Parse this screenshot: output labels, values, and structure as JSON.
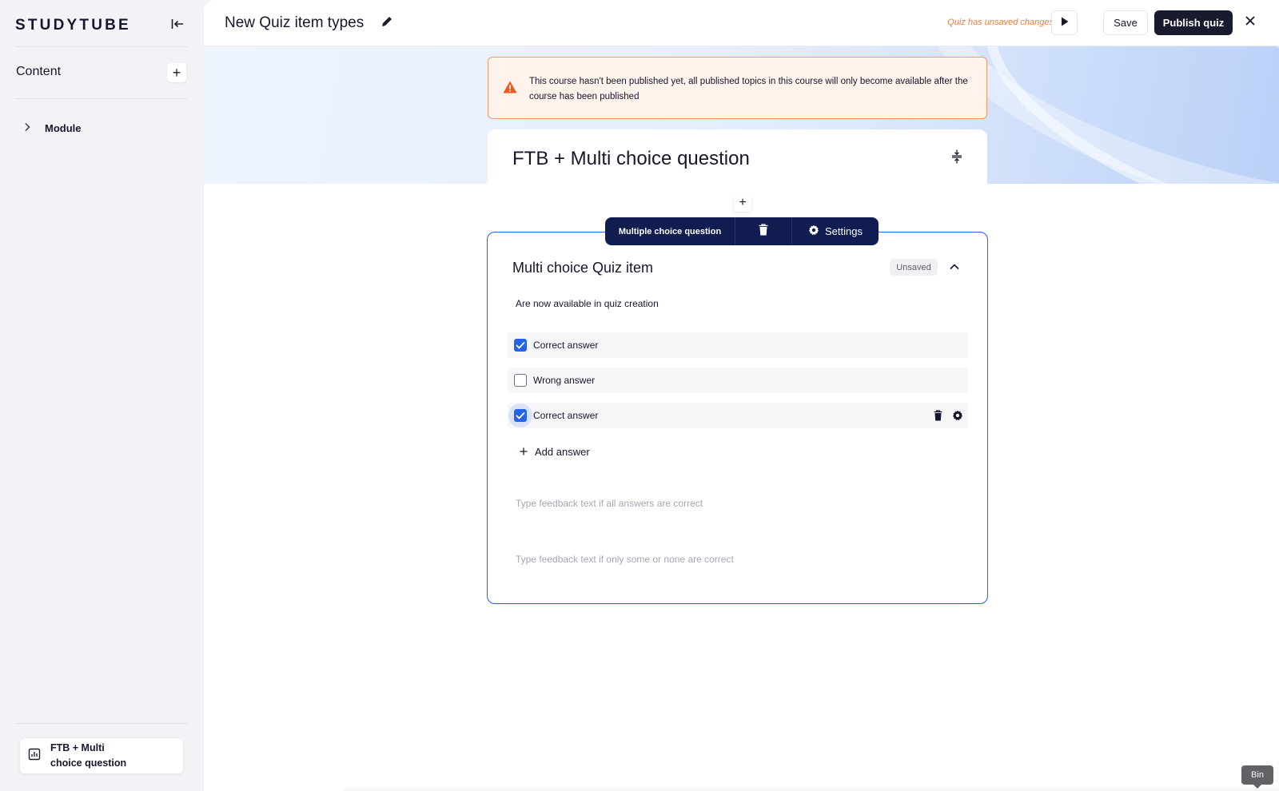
{
  "sidebar": {
    "logo": "STUDYTUBE",
    "content_label": "Content",
    "add_label": "+",
    "module_label": "Module",
    "bottom_item_label": "FTB + Multi choice question"
  },
  "topbar": {
    "title": "New Quiz item types",
    "unsaved_note": "Quiz has unsaved changes",
    "save_label": "Save",
    "publish_label": "Publish quiz"
  },
  "notice": {
    "text": "This course hasn't been published yet, all published topics in this course will only become available after the course has been published"
  },
  "topic": {
    "title": "FTB + Multi choice question"
  },
  "add_block_label": "+",
  "toolbar": {
    "type_label": "Multiple choice question",
    "settings_label": "Settings"
  },
  "quiz_item": {
    "title": "Multi choice Quiz item",
    "status_badge": "Unsaved",
    "question": "Are now available in quiz creation",
    "answers": [
      {
        "label": "Correct answer",
        "checked": true
      },
      {
        "label": "Wrong answer",
        "checked": false
      },
      {
        "label": "Correct answer",
        "checked": true
      }
    ],
    "add_answer_label": "Add answer",
    "feedback_correct_placeholder": "Type feedback text if all answers are correct",
    "feedback_incorrect_placeholder": "Type feedback text if only some or none are correct"
  },
  "tooltip": {
    "bin_label": "Bin"
  },
  "colors": {
    "accent": "#2563eb",
    "toolbar_bg": "#111c50",
    "publish_bg": "#181a2e",
    "warning": "#ef5a1f",
    "unsaved_text": "#ef7b3c"
  },
  "icons": [
    "collapse-sidebar-icon",
    "chevron-right-icon",
    "chart-icon",
    "pencil-icon",
    "play-icon",
    "close-icon",
    "warning-icon",
    "collapse-all-icon",
    "trash-icon",
    "gear-icon",
    "chevron-up-icon",
    "check-icon",
    "plus-icon"
  ]
}
